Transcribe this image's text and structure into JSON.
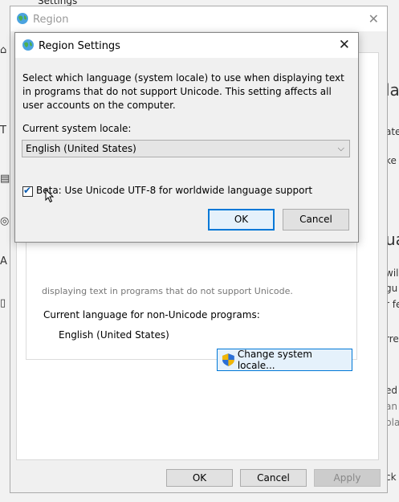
{
  "background_app": {
    "title": "Settings",
    "right_fragments": [
      "la",
      "ate",
      "ke",
      "ua",
      "will",
      "gu",
      "r fe",
      "rre",
      "ed",
      "an",
      "pla",
      "ck"
    ]
  },
  "region_window": {
    "title": "Region",
    "partial_text": "displaying text in programs that do not support Unicode.",
    "language_label": "Current language for non-Unicode programs:",
    "language_value": "English (United States)",
    "change_locale_button": "Change system locale...",
    "ok_button": "OK",
    "cancel_button": "Cancel",
    "apply_button": "Apply"
  },
  "dialog": {
    "title": "Region Settings",
    "description": "Select which language (system locale) to use when displaying text in programs that do not support Unicode. This setting affects all user accounts on the computer.",
    "locale_label": "Current system locale:",
    "locale_value": "English (United States)",
    "beta_checkbox_label": "Beta: Use Unicode UTF-8 for worldwide language support",
    "beta_checked": true,
    "ok_button": "OK",
    "cancel_button": "Cancel"
  },
  "colors": {
    "accent": "#0078d7",
    "button_bg": "#e1e1e1",
    "window_bg": "#f0f0f0"
  }
}
